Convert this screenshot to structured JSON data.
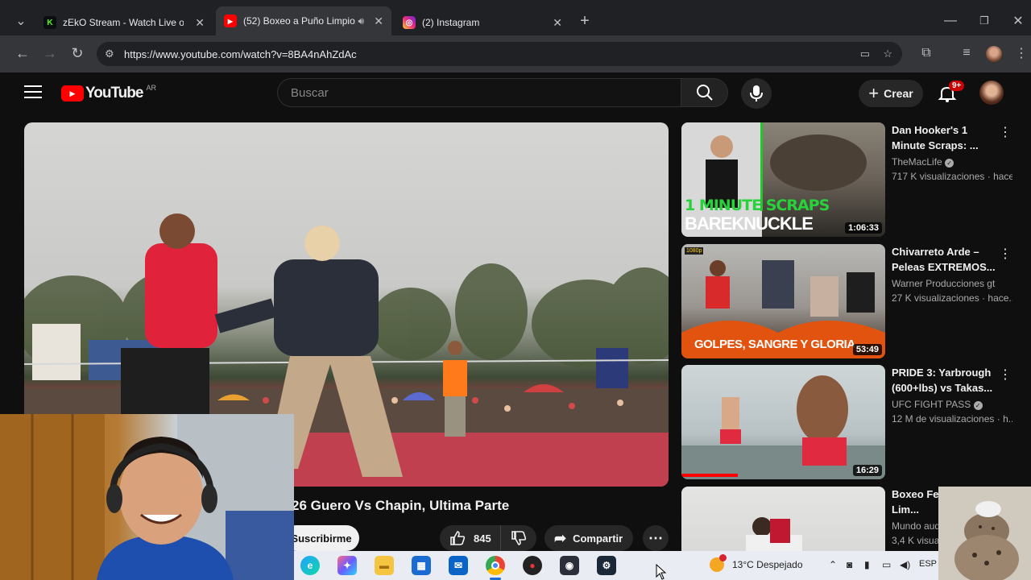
{
  "browser": {
    "tabs": [
      {
        "label": "zEkO Stream - Watch Live on Kick",
        "favicon": "K",
        "color": "#53fc18"
      },
      {
        "label": "(52) Boxeo a Puño Limpio, ...",
        "favicon": "▶",
        "color": "#ff0000"
      },
      {
        "label": "(2) Instagram",
        "favicon": "◎",
        "color": "#d62976"
      }
    ],
    "url": "https://www.youtube.com/watch?v=8BA4nAhZdAc"
  },
  "youtube": {
    "logo_text": "YouTube",
    "region": "AR",
    "search_placeholder": "Buscar",
    "create_label": "Crear",
    "notifications_badge": "9+"
  },
  "video": {
    "title": "26 Guero Vs Chapin, Ultima Parte",
    "subscribe_label": "Suscribirme",
    "likes": "845",
    "share_label": "Compartir"
  },
  "recommendations": [
    {
      "title": "Dan Hooker's 1 Minute Scraps: ...",
      "channel": "TheMacLife",
      "verified": true,
      "meta": "717 K visualizaciones · hace...",
      "duration": "1:06:33",
      "overlay_top": "1 MINUTE SCRAPS",
      "overlay_bottom": "BAREKNUCKLE"
    },
    {
      "title": "Chivarreto Arde – Peleas EXTREMOS...",
      "channel": "Warner Producciones gt",
      "verified": false,
      "meta": "27 K visualizaciones · hace...",
      "duration": "53:49",
      "overlay_bottom": "GOLPES, SANGRE Y GLORIA",
      "badge": "1080p"
    },
    {
      "title": "PRIDE 3: Yarbrough (600+lbs) vs Takas...",
      "channel": "UFC FIGHT PASS",
      "verified": true,
      "meta": "12 M de visualizaciones · h...",
      "duration": "16:29"
    },
    {
      "title": "Boxeo Fer... Puño Lim...",
      "channel": "Mundo aud...",
      "verified": false,
      "meta": "3,4 K visual..."
    }
  ],
  "taskbar": {
    "weather": "13°C  Despejado",
    "language": "ESP"
  },
  "colors": {
    "yt_red": "#ff0000",
    "bg": "#0f0f0f",
    "pill": "#272727"
  }
}
